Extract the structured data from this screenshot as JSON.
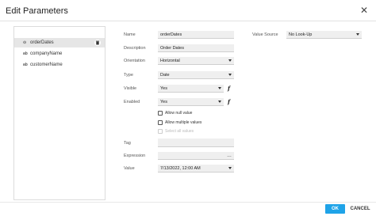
{
  "dialog": {
    "title": "Edit Parameters",
    "close_glyph": "✕"
  },
  "toolbar": {
    "icons": [
      "add-parameter-icon",
      "remove-parameter-icon",
      "reorder-icon",
      "move-up-icon",
      "move-down-icon"
    ],
    "up_glyph": "▲",
    "down_glyph": "▼"
  },
  "parameters": [
    {
      "type_icon": "⊙",
      "name": "orderDates",
      "selected": true
    },
    {
      "type_icon": "ab",
      "name": "companyName",
      "selected": false
    },
    {
      "type_icon": "ab",
      "name": "customerName",
      "selected": false
    }
  ],
  "properties": {
    "name": {
      "label": "Name",
      "value": "orderDates"
    },
    "description": {
      "label": "Description",
      "value": "Order Dates"
    },
    "orientation": {
      "label": "Orientation",
      "value": "Horizontal"
    },
    "type": {
      "label": "Type",
      "value": "Date"
    },
    "visible": {
      "label": "Visible",
      "value": "Yes"
    },
    "enabled": {
      "label": "Enabled",
      "value": "Yes"
    },
    "allow_null": {
      "label": "Allow null value",
      "checked": false
    },
    "allow_multiple": {
      "label": "Allow multiple values",
      "checked": false
    },
    "select_all": {
      "label": "Select all values",
      "checked": false,
      "disabled": true
    },
    "tag": {
      "label": "Tag",
      "value": ""
    },
    "expression": {
      "label": "Expression",
      "value": "",
      "button": "…"
    },
    "value": {
      "label": "Value",
      "value": "7/13/2022, 12:00 AM"
    },
    "fx_glyph": "f",
    "value_source": {
      "label": "Value Source",
      "value": "No Look-Up"
    }
  },
  "footer": {
    "ok_label": "OK",
    "cancel_label": "CANCEL"
  },
  "colors": {
    "primary": "#1fa3e8",
    "selected_row": "#e6e6e6",
    "field_bg": "#efefef"
  }
}
